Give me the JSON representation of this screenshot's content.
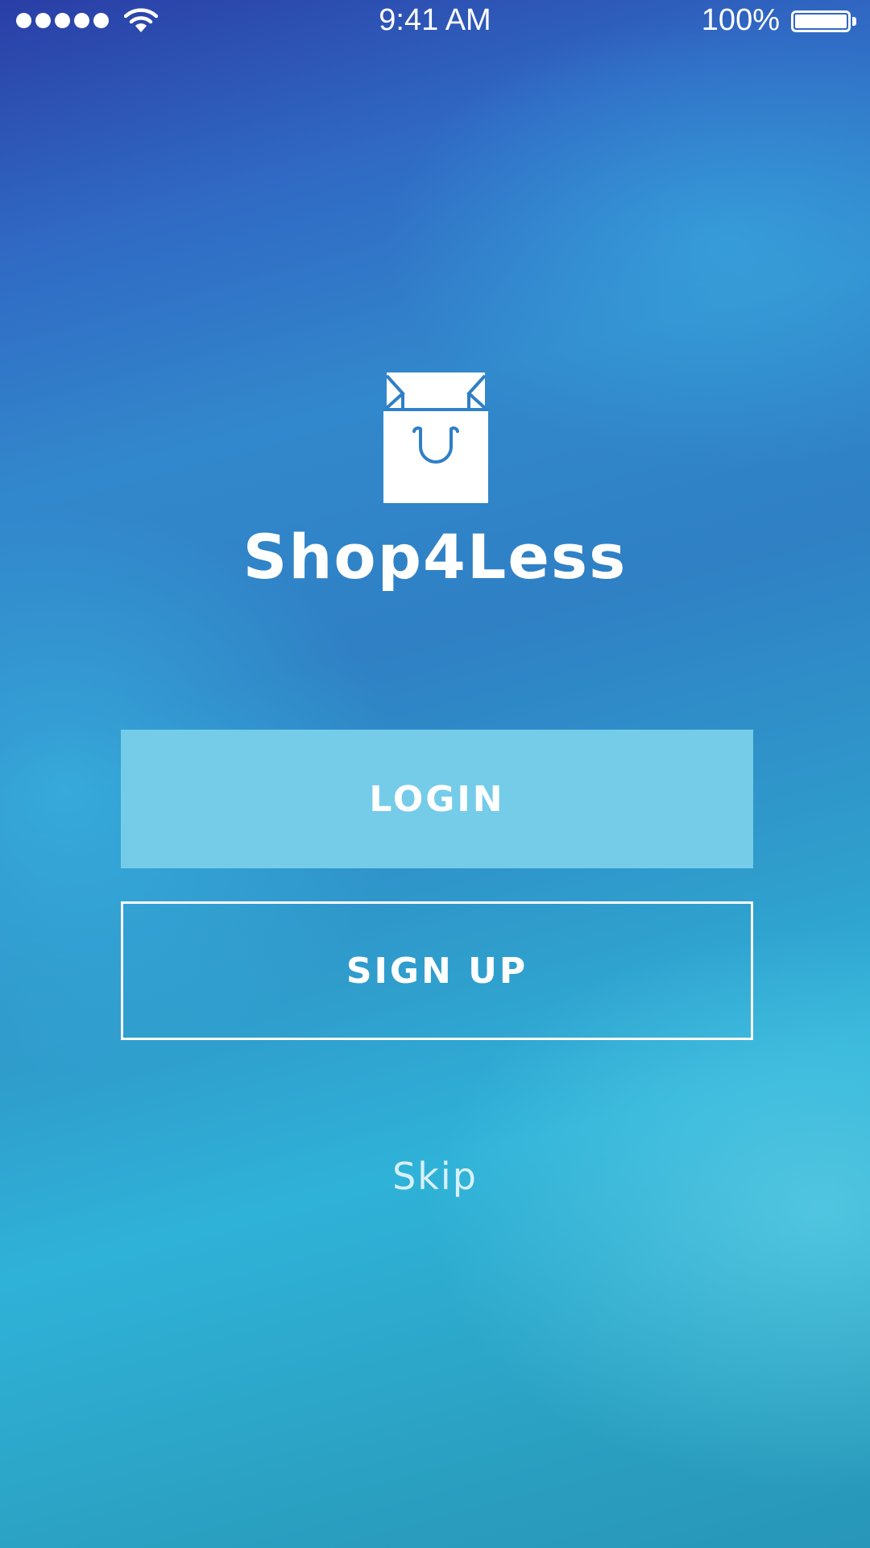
{
  "status_bar": {
    "time": "9:41 AM",
    "battery_percent": "100%",
    "battery_level": 1.0,
    "signal_bars": 5,
    "icons": [
      "signal-dots-icon",
      "wifi-icon",
      "battery-icon"
    ]
  },
  "app": {
    "logo_icon": "shopping-bag-smile-icon",
    "name": "Shop4Less"
  },
  "actions": {
    "login_label": "LOGIN",
    "signup_label": "SIGN UP",
    "skip_label": "Skip"
  },
  "colors": {
    "background_top": "#2a3ea6",
    "background_bottom": "#2896b8",
    "login_fill": "#74cce8",
    "logo_accent": "#2f7fc6",
    "text": "#ffffff"
  }
}
